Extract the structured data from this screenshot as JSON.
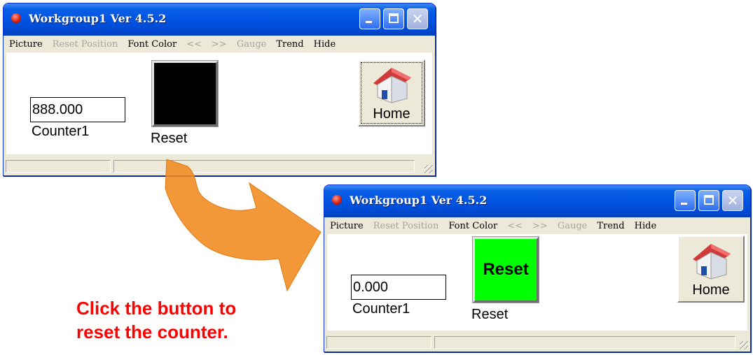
{
  "colors": {
    "caption": "#ff0000",
    "arrow": "#f08a1c",
    "reset_before": "#000000",
    "reset_after": "#00ff00"
  },
  "before": {
    "title": "Workgroup1 Ver 4.5.2",
    "menu": [
      "Picture",
      "Reset Position",
      "Font Color",
      "<<",
      ">>",
      "Gauge",
      "Trend",
      "Hide"
    ],
    "counter_value": "888.000",
    "counter_label": "Counter1",
    "reset_face": "",
    "reset_label": "Reset",
    "home_label": "Home"
  },
  "after": {
    "title": "Workgroup1 Ver 4.5.2",
    "menu": [
      "Picture",
      "Reset Position",
      "Font Color",
      "<<",
      ">>",
      "Gauge",
      "Trend",
      "Hide"
    ],
    "counter_value": "0.000",
    "counter_label": "Counter1",
    "reset_face": "Reset",
    "reset_label": "Reset",
    "home_label": "Home"
  },
  "caption": {
    "line1": "Click the button to",
    "line2": "reset the counter."
  }
}
